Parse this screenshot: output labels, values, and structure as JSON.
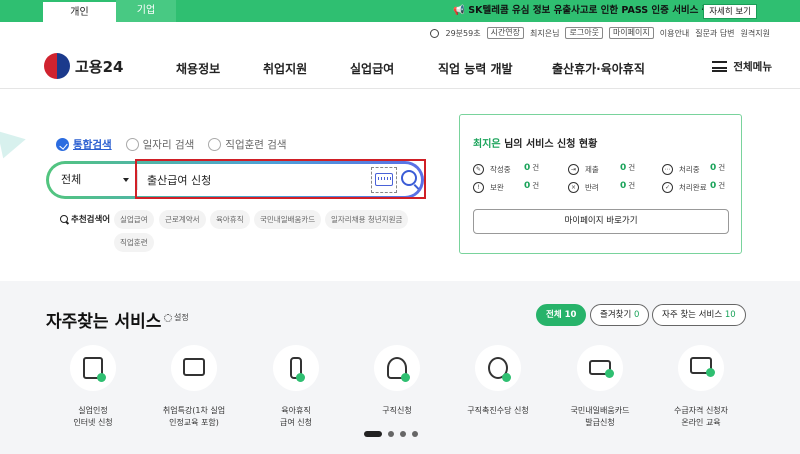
{
  "topbar": {
    "tabs": [
      "개인",
      "기업"
    ],
    "notice": "SK텔레콤 유심 정보 유출사고로 인한 PASS 인증 서비스 중단 안내",
    "notice_button": "자세히 보기"
  },
  "util": {
    "timer": "29분59초",
    "extend": "시간연장",
    "user": "최지은님",
    "logout": "로그아웃",
    "mypage": "마이페이지",
    "guide": "이용안내",
    "qa": "질문과 답변",
    "remote": "원격지원"
  },
  "header": {
    "logo": "고용24",
    "nav": [
      "채용정보",
      "취업지원",
      "실업급여",
      "직업 능력 개발",
      "출산휴가·육아휴직"
    ],
    "menu_all": "전체메뉴"
  },
  "search": {
    "types": [
      "통합검색",
      "일자리 검색",
      "직업훈련 검색"
    ],
    "selected_type": "통합검색",
    "scope": "전체",
    "query": "출산급여 신청",
    "rec_label": "추천검색어",
    "keywords": [
      "실업급여",
      "근로계약서",
      "육아휴직",
      "국민내일배움카드",
      "일자리채용 청년지원금",
      "직업훈련"
    ]
  },
  "panel": {
    "user_name": "최지은",
    "title_suffix": " 님의 서비스 신청 현황",
    "stats": [
      {
        "label": "작성중",
        "value": "0",
        "unit": "건",
        "icon": "pencil-icon"
      },
      {
        "label": "제출",
        "value": "0",
        "unit": "건",
        "icon": "submit-icon"
      },
      {
        "label": "처리중",
        "value": "0",
        "unit": "건",
        "icon": "more-icon"
      },
      {
        "label": "보완",
        "value": "0",
        "unit": "건",
        "icon": "alert-icon"
      },
      {
        "label": "반려",
        "value": "0",
        "unit": "건",
        "icon": "reject-icon"
      },
      {
        "label": "처리완료",
        "value": "0",
        "unit": "건",
        "icon": "check-icon"
      }
    ],
    "button": "마이페이지 바로가기"
  },
  "freq": {
    "title": "자주찾는 서비스",
    "setting": "설정",
    "pills": [
      {
        "label": "전체",
        "count": "10"
      },
      {
        "label": "즐겨찾기",
        "count": "0"
      },
      {
        "label": "자주 찾는 서비스",
        "count": "10"
      }
    ],
    "services": [
      {
        "label": "실업인정\n인터넷 신청",
        "icon": "document-icon"
      },
      {
        "label": "취업특강(1차 실업\n인정교육 포함)",
        "icon": "presentation-icon"
      },
      {
        "label": "육아휴직\n급여 신청",
        "icon": "baby-bottle-icon"
      },
      {
        "label": "구직신청",
        "icon": "person-icon"
      },
      {
        "label": "구직촉진수당 신청",
        "icon": "money-bag-icon"
      },
      {
        "label": "국민내일배움카드\n발급신청",
        "icon": "card-icon"
      },
      {
        "label": "수급자격 신청자\n온라인 교육",
        "icon": "monitor-icon"
      }
    ]
  }
}
